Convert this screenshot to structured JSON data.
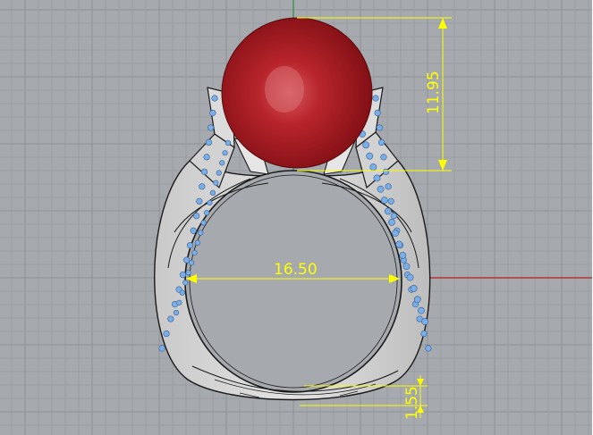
{
  "viewport": {
    "colors": {
      "background": "#a6a9ae",
      "grid_minor": "#9a9da2",
      "grid_major": "#8e9196",
      "axis_x": "#b51f1f",
      "axis_y": "#2e8b3e",
      "dimension": "#ffff00",
      "gem": "#a4161c",
      "prongs": "#7aaee8",
      "metal_outline": "#1a1a1a"
    }
  },
  "dimensions": {
    "gem_height": "11.95",
    "inner_diameter": "16.50",
    "band_thickness": "1.55"
  },
  "model": {
    "gem_icon": "sphere-gem-icon",
    "ring_icon": "ring-band-icon",
    "stones_icon": "pave-stones-icon"
  }
}
